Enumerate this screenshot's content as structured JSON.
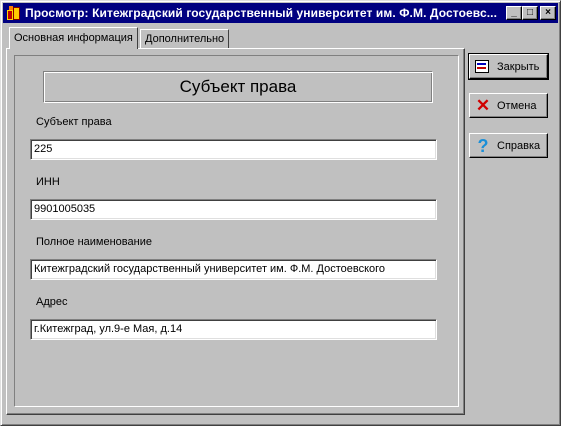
{
  "window": {
    "title": "Просмотр: Китежградский государственный университет им. Ф.М. Достоевс...",
    "icon": "app-books-icon",
    "controls": {
      "minimize": "_",
      "maximize": "□",
      "close": "×"
    }
  },
  "tabs": [
    {
      "label": "Основная информация",
      "active": true
    },
    {
      "label": "Дополнительно",
      "active": false
    }
  ],
  "form": {
    "header": "Субъект права",
    "fields": [
      {
        "label": "Субъект права",
        "value": "225"
      },
      {
        "label": "ИНН",
        "value": "9901005035"
      },
      {
        "label": "Полное наименование",
        "value": "Китежградский государственный университет им. Ф.М. Достоевского"
      },
      {
        "label": "Адрес",
        "value": "г.Китежград, ул.9-е Мая, д.14"
      }
    ]
  },
  "buttons": {
    "close": {
      "label": "Закрыть",
      "icon": "close-form-icon"
    },
    "cancel": {
      "label": "Отмена",
      "icon": "red-x-icon"
    },
    "help": {
      "label": "Справка",
      "icon": "question-mark-icon"
    }
  },
  "colors": {
    "title_bar": "#000080",
    "face": "#c0c0c0"
  }
}
